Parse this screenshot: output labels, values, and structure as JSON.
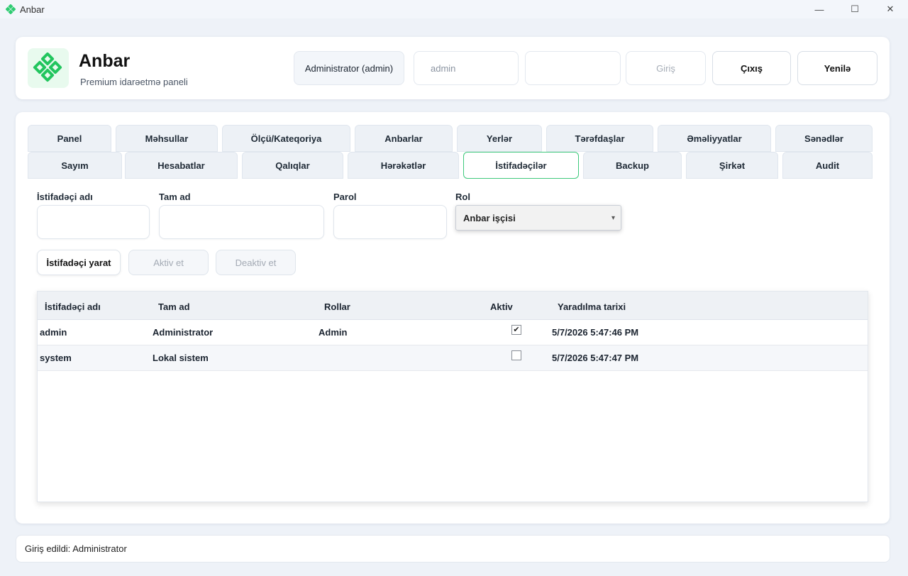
{
  "window": {
    "title": "Anbar",
    "controls": {
      "minimize": "—",
      "maximize": "☐",
      "close": "✕"
    }
  },
  "header": {
    "brand_title": "Anbar",
    "brand_subtitle": "Premium idarəetmə paneli",
    "current_user": "Administrator (admin)",
    "login_value": "admin",
    "password_value": "",
    "login_button": "Giriş",
    "logout_button": "Çıxış",
    "refresh_button": "Yenilə"
  },
  "tabs_row1": [
    "Panel",
    "Məhsullar",
    "Ölçü/Kateqoriya",
    "Anbarlar",
    "Yerlər",
    "Tərəfdaşlar",
    "Əməliyyatlar",
    "Sənədlər"
  ],
  "tabs_row2": [
    "Sayım",
    "Hesabatlar",
    "Qalıqlar",
    "Hərəkətlər",
    "İstifadəçilər",
    "Backup",
    "Şirkət",
    "Audit"
  ],
  "active_tab": "İstifadəçilər",
  "form": {
    "username_label": "İstifadəçi adı",
    "fullname_label": "Tam ad",
    "password_label": "Parol",
    "role_label": "Rol",
    "role_selected": "Anbar işçisi"
  },
  "actions": {
    "create": "İstifadəçi yarat",
    "activate": "Aktiv et",
    "deactivate": "Deaktiv et"
  },
  "table": {
    "columns": [
      "İstifadəçi adı",
      "Tam ad",
      "Rollar",
      "Aktiv",
      "Yaradılma tarixi"
    ],
    "rows": [
      {
        "username": "admin",
        "fullname": "Administrator",
        "roles": "Admin",
        "active": true,
        "created": "5/7/2026 5:47:46 PM"
      },
      {
        "username": "system",
        "fullname": "Lokal sistem",
        "roles": "",
        "active": false,
        "created": "5/7/2026 5:47:47 PM"
      }
    ]
  },
  "status": {
    "text": "Giriş edildi: Administrator"
  },
  "colors": {
    "accent": "#3ec97c",
    "logo_green": "#2ecc71"
  },
  "icons": {
    "app": "green-diamond-logo-icon",
    "select": "chevron-down-icon",
    "checked": "✔"
  }
}
